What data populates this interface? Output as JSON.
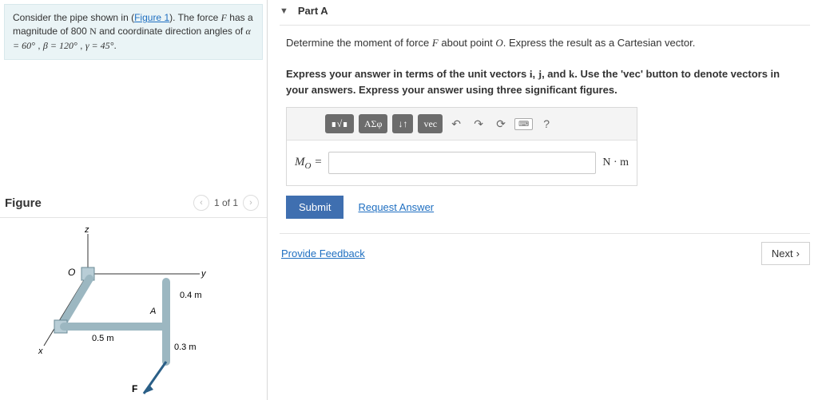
{
  "problem": {
    "text_prefix": "Consider the pipe shown in (",
    "figure_link": "Figure 1",
    "text_mid": "). The force ",
    "force_sym": "F",
    "text_mag": " has a magnitude of 800 ",
    "unit_N": "N",
    "text_angles": " and coordinate direction angles of ",
    "alpha": "α = 60°",
    "beta": "β = 120°",
    "gamma": "γ = 45°",
    "period": "."
  },
  "figure": {
    "title": "Figure",
    "pager": "1 of 1",
    "labels": {
      "z": "z",
      "y": "y",
      "x": "x",
      "O": "O",
      "A": "A",
      "F": "F",
      "d1": "0.5 m",
      "d2": "0.4 m",
      "d3": "0.3 m"
    }
  },
  "part": {
    "label": "Part A",
    "q1": "Determine the moment of force ",
    "q1b": " about point ",
    "q1c": ". Express the result as a Cartesian vector.",
    "q2a": "Express your answer in terms of the unit vectors ",
    "i": "i",
    "j": "j",
    "k": "k",
    "q2b": ". Use the 'vec' button to denote vectors in your answers. Express your answer using three significant figures.",
    "O": "O",
    "F": "F"
  },
  "toolbar": {
    "tmpl": "∎√∎",
    "greek": "ΑΣφ",
    "updown": "↓↑",
    "vec": "vec",
    "undo": "↶",
    "redo": "↷",
    "reset": "⟳",
    "keyboard": "⌨",
    "help": "?"
  },
  "answer": {
    "lhs_M": "M",
    "lhs_sub": "O",
    "eq": " = ",
    "unit": "N · m"
  },
  "buttons": {
    "submit": "Submit",
    "request": "Request Answer",
    "feedback": "Provide Feedback",
    "next": "Next"
  }
}
